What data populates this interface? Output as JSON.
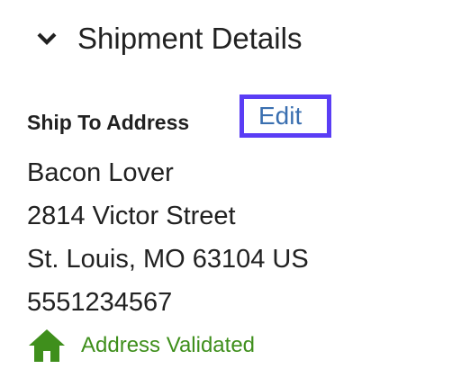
{
  "section": {
    "title": "Shipment Details",
    "toggle_icon": "chevron-down-icon"
  },
  "ship_to": {
    "label": "Ship To Address",
    "edit_label": "Edit",
    "address_lines": [
      "Bacon Lover",
      "2814 Victor Street",
      "St. Louis, MO 63104 US",
      "5551234567"
    ],
    "validation": {
      "icon": "home-icon",
      "text": "Address Validated",
      "color": "#3f8f1c"
    }
  },
  "colors": {
    "highlight_border": "#5a3df5",
    "link": "#3a6fb0",
    "text": "#212121"
  }
}
